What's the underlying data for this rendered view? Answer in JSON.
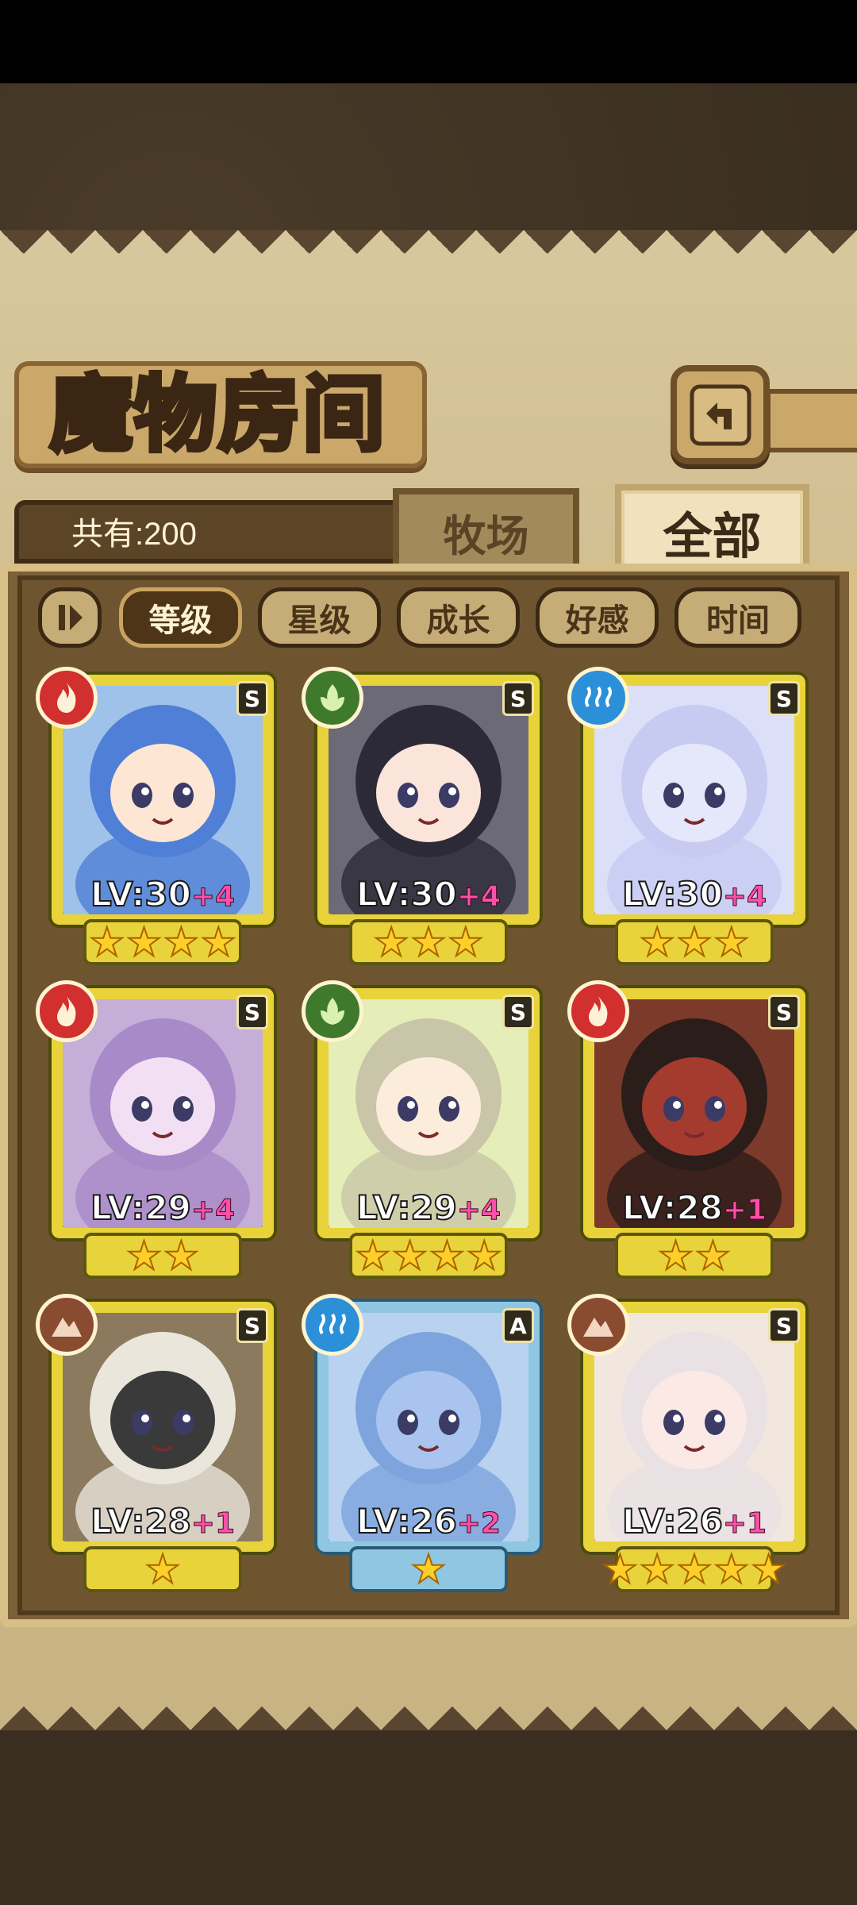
{
  "title": "魔物房间",
  "count_label": "共有:200",
  "tabs": {
    "ranch": "牧场",
    "all": "全部"
  },
  "sort": [
    "等级",
    "星级",
    "成长",
    "好感",
    "时间"
  ],
  "sort_active": "等级",
  "cards": [
    {
      "element": "fire",
      "rank": "S",
      "lv": "LV:30",
      "plus": "+4",
      "stars": 4,
      "hair": "#4f7fd6",
      "skin": "#fde6d4",
      "bg": "#9fc2ea"
    },
    {
      "element": "nature",
      "rank": "S",
      "lv": "LV:30",
      "plus": "+4",
      "stars": 3,
      "hair": "#2d2a37",
      "skin": "#fbe5da",
      "bg": "#6d6a78"
    },
    {
      "element": "water",
      "rank": "S",
      "lv": "LV:30",
      "plus": "+4",
      "stars": 3,
      "hair": "#c7cbf2",
      "skin": "#e5e7fb",
      "bg": "#dcdff8"
    },
    {
      "element": "fire",
      "rank": "S",
      "lv": "LV:29",
      "plus": "+4",
      "stars": 2,
      "hair": "#a88ac8",
      "skin": "#f2dff3",
      "bg": "#c5aed8"
    },
    {
      "element": "nature",
      "rank": "S",
      "lv": "LV:29",
      "plus": "+4",
      "stars": 4,
      "hair": "#c9c5a8",
      "skin": "#fcecdc",
      "bg": "#e5edb9"
    },
    {
      "element": "fire",
      "rank": "S",
      "lv": "LV:28",
      "plus": "+1",
      "stars": 2,
      "hair": "#2a1d1a",
      "skin": "#a33c2e",
      "bg": "#7c3a2b"
    },
    {
      "element": "earth",
      "rank": "S",
      "lv": "LV:28",
      "plus": "+1",
      "stars": 1,
      "hair": "#eae6dc",
      "skin": "#3a3a3a",
      "bg": "#8b7a5d"
    },
    {
      "element": "water",
      "rank": "A",
      "lv": "LV:26",
      "plus": "+2",
      "stars": 1,
      "hair": "#7ea4dd",
      "skin": "#a9c5ef",
      "bg": "#b8d2f0"
    },
    {
      "element": "earth",
      "rank": "S",
      "lv": "LV:26",
      "plus": "+1",
      "stars": 5,
      "hair": "#e9e1e4",
      "skin": "#fbe9e6",
      "bg": "#f1e7de"
    }
  ]
}
